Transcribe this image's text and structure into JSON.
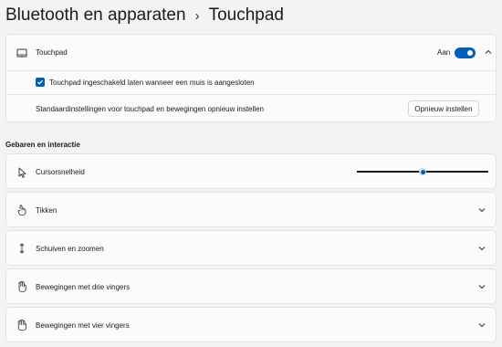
{
  "breadcrumb": {
    "parent": "Bluetooth en apparaten",
    "separator": "›",
    "current": "Touchpad"
  },
  "touchpad_card": {
    "label": "Touchpad",
    "icon": "touchpad-icon",
    "toggle_state_label": "Aan",
    "toggle_on": true,
    "checkbox_label": "Touchpad ingeschakeld laten wanneer een muis is aangesloten",
    "checkbox_checked": true,
    "reset_label": "Standaardinstellingen voor touchpad en bewegingen opnieuw instellen",
    "reset_button": "Opnieuw instellen"
  },
  "section": {
    "title": "Gebaren en interactie"
  },
  "items": [
    {
      "label": "Cursorsnelheid",
      "icon": "cursor-icon",
      "slider_value": 0.5
    },
    {
      "label": "Tikken",
      "icon": "tap-icon"
    },
    {
      "label": "Schuiven en zoomen",
      "icon": "scroll-zoom-icon"
    },
    {
      "label": "Bewegingen met drie vingers",
      "icon": "three-finger-icon"
    },
    {
      "label": "Bewegingen met vier vingers",
      "icon": "four-finger-icon"
    }
  ],
  "colors": {
    "accent": "#005fb8",
    "background": "#f3f3f3",
    "card": "#fbfbfb"
  }
}
